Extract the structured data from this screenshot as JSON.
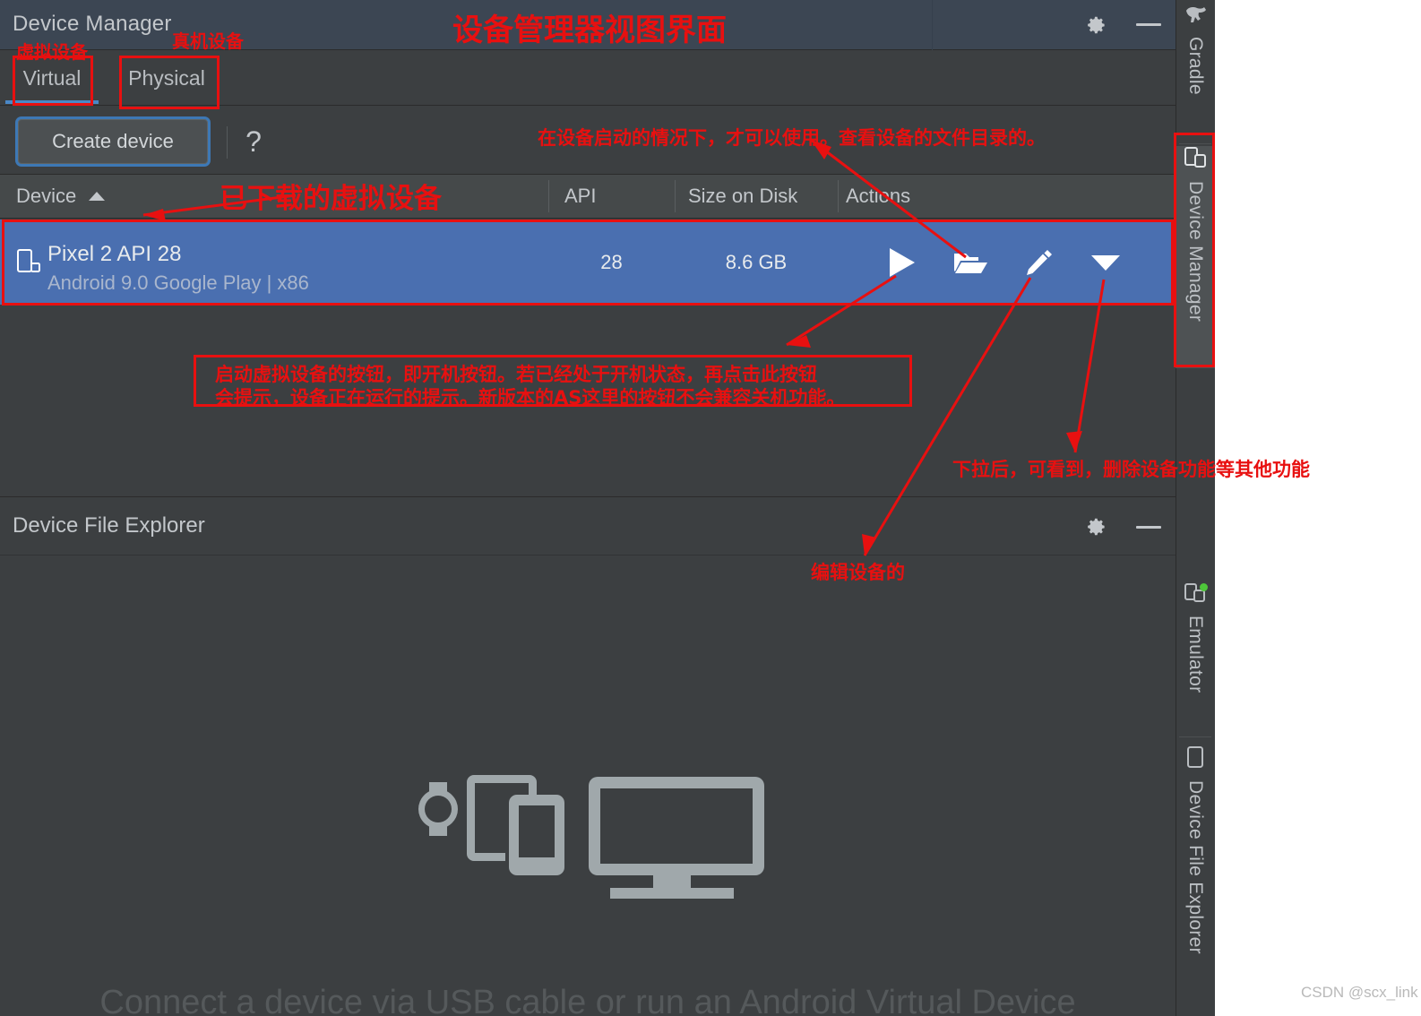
{
  "window": {
    "tool_window_title": "Device Manager",
    "gear_icon": "gear-icon",
    "minimize_icon": "minimize-icon"
  },
  "tabs": {
    "virtual": "Virtual",
    "physical": "Physical",
    "selected": "Virtual"
  },
  "toolbar": {
    "create_device": "Create device",
    "help": "?"
  },
  "table": {
    "columns": [
      "Device",
      "API",
      "Size on Disk",
      "Actions"
    ],
    "sort_column": "Device",
    "sort_direction": "ascending",
    "rows": [
      {
        "device_icon": "virtual-device-icon",
        "name": "Pixel 2 API 28",
        "details": "Android 9.0 Google Play | x86",
        "api": "28",
        "size_on_disk": "8.6 GB",
        "actions": [
          "play-icon",
          "folder-icon",
          "pencil-icon",
          "chevron-down-icon"
        ],
        "selected": true
      }
    ]
  },
  "file_explorer": {
    "title": "Device File Explorer",
    "empty_message": "Connect a device via USB cable or run an Android Virtual Device",
    "illustration": "devices-illustration",
    "gear_icon": "gear-icon",
    "minimize_icon": "minimize-icon"
  },
  "right_rail": [
    {
      "label": "Gradle",
      "icon": "gradle-elephant-icon",
      "active": false
    },
    {
      "label": "Device Manager",
      "icon": "device-manager-icon",
      "active": true
    },
    {
      "label": "Emulator",
      "icon": "emulator-icon",
      "active": false,
      "status_dot": "#4ec63a"
    },
    {
      "label": "Device File Explorer",
      "icon": "device-file-explorer-icon",
      "active": false
    }
  ],
  "annotations": {
    "color": "#e81010",
    "title": "设备管理器视图界面",
    "virtual_label": "虚拟设备",
    "physical_label": "真机设备",
    "downloaded_devices": "已下载的虚拟设备",
    "file_explorer_note": "在设备启动的情况下，才可以使用。查看设备的文件目录的。",
    "play_note_line1": "启动虚拟设备的按钮，即开机按钮。若已经处于开机状态，再点击此按钮",
    "play_note_line2": "会提示，设备正在运行的提示。新版本的AS这里的按钮不会兼容关机功能。",
    "dropdown_note": "下拉后，可看到，删除设备功能等其他功能",
    "edit_note": "编辑设备的"
  },
  "watermark": "CSDN @scx_link"
}
